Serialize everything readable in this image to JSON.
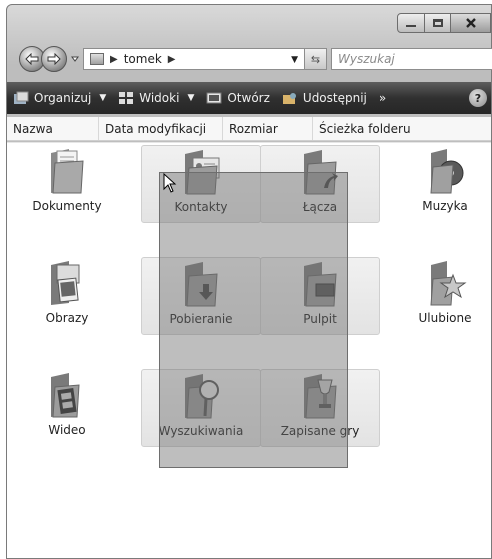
{
  "window": {
    "caption_buttons": [
      "minimize-icon",
      "maximize-icon",
      "close-icon"
    ]
  },
  "address_bar": {
    "path": [
      "tomek"
    ],
    "search_placeholder": "Wyszukaj"
  },
  "toolbar": {
    "organize": "Organizuj",
    "views": "Widoki",
    "open": "Otwórz",
    "share": "Udostępnij",
    "more": "»",
    "help": "?"
  },
  "columns": [
    "Nazwa",
    "Data modyfikacji",
    "Rozmiar",
    "Ścieżka folderu"
  ],
  "items": [
    {
      "name": "Dokumenty",
      "icon": "documents-folder-icon",
      "selected": false
    },
    {
      "name": "Kontakty",
      "icon": "contacts-folder-icon",
      "selected": true
    },
    {
      "name": "Łącza",
      "icon": "links-folder-icon",
      "selected": true
    },
    {
      "name": "Muzyka",
      "icon": "music-folder-icon",
      "selected": false
    },
    {
      "name": "Obrazy",
      "icon": "pictures-folder-icon",
      "selected": false
    },
    {
      "name": "Pobieranie",
      "icon": "downloads-folder-icon",
      "selected": true
    },
    {
      "name": "Pulpit",
      "icon": "desktop-folder-icon",
      "selected": true
    },
    {
      "name": "Ulubione",
      "icon": "favorites-folder-icon",
      "selected": false
    },
    {
      "name": "Wideo",
      "icon": "videos-folder-icon",
      "selected": false
    },
    {
      "name": "Wyszukiwania",
      "icon": "searches-folder-icon",
      "selected": true
    },
    {
      "name": "Zapisane gry",
      "icon": "saved-games-folder-icon",
      "selected": true
    }
  ]
}
